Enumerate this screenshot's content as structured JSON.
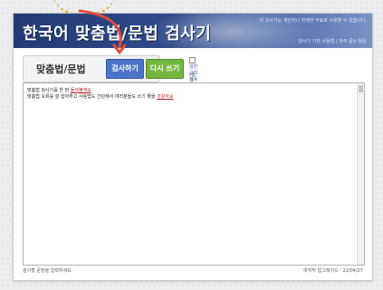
{
  "header": {
    "title": "한국어 맞춤법/문법 검사기",
    "notice": "이 검사기는 개인이나 학생만 무료로 사용할 수 있습니다.",
    "links": "검사기 기본 사용법 | 자주 묻는 질문"
  },
  "toolbar": {
    "app_label": "맞춤법/문법",
    "check_label": "검사하기",
    "reset_label": "다시 쓰기",
    "option_label": "강한 규칙 적용하기",
    "count_label": "(총 글자 수)"
  },
  "editor": {
    "line1_prefix": "맞춤법 검사기를 한 번 ",
    "line1_highlight": "돌려볼게요",
    "line2_prefix": "맞춤법 오류를 잘 잡아주고 사용법도 간단해서 여러분들도 쓰기 좋을 ",
    "line2_highlight": "것같아요"
  },
  "footer": {
    "left": "검사할 문장을 입력하세요.",
    "right": "마지막 업그레이드 : 22/04/27"
  },
  "colors": {
    "header_dark": "#233a73",
    "check_button": "#4a74c9",
    "reset_button": "#74b73f",
    "error_text": "#c0202a"
  }
}
